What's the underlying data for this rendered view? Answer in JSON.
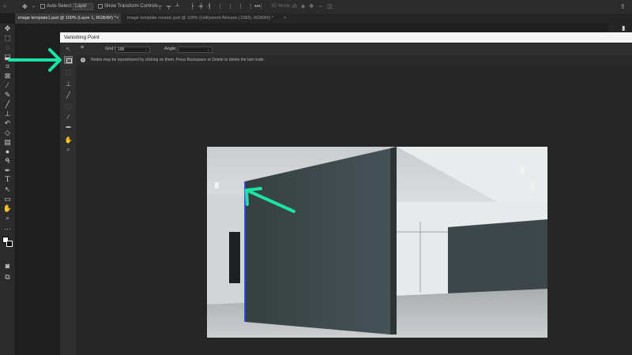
{
  "options_bar": {
    "auto_select_label": "Auto-Select:",
    "auto_select_target": "Layer",
    "show_transform_label": "Show Transform Controls",
    "mode_3d_label": "3D Mode:",
    "more_label": "•••"
  },
  "tabs": [
    {
      "label": "image template1.psd @ 100% (Layer 1, RGB/8#) *",
      "close": "×",
      "active": true
    },
    {
      "label": "image template mosaic.psd @ 100% (Hollywood Africans (1983), RGB/8#) *",
      "close": "×",
      "active": false
    }
  ],
  "vanishing_point": {
    "title": "Vanishing Point",
    "options": {
      "grid_size_label": "Grid Size:",
      "grid_size_value": "100",
      "angle_label": "Angle:",
      "angle_value": ""
    },
    "info_text": "Nodes may be repositioned by clicking on them. Press Backspace or Delete to delete the last node."
  },
  "colors": {
    "annotation_arrow": "#19e3a5",
    "dialog_bg": "#262626",
    "titlebar": "#f5f5f5",
    "wall": "#3a4649"
  },
  "icons": {
    "main_tools": [
      "move-icon",
      "marquee-icon",
      "lasso-icon",
      "object-select-icon",
      "crop-icon",
      "frame-icon",
      "eyedropper-icon",
      "spot-healing-icon",
      "brush-icon",
      "clone-stamp-icon",
      "history-brush-icon",
      "eraser-icon",
      "gradient-icon",
      "blur-icon",
      "dodge-icon",
      "pen-icon",
      "type-icon",
      "path-select-icon",
      "rectangle-icon",
      "hand-icon",
      "zoom-icon",
      "more-tools-icon",
      "color-swatches-icon",
      "quick-mask-icon",
      "screen-mode-icon"
    ],
    "vp_tools": [
      "edit-plane-icon",
      "create-plane-icon",
      "marquee-icon",
      "stamp-icon",
      "brush-icon",
      "transform-icon",
      "eyedropper-icon",
      "measure-icon",
      "hand-icon",
      "zoom-icon"
    ]
  }
}
